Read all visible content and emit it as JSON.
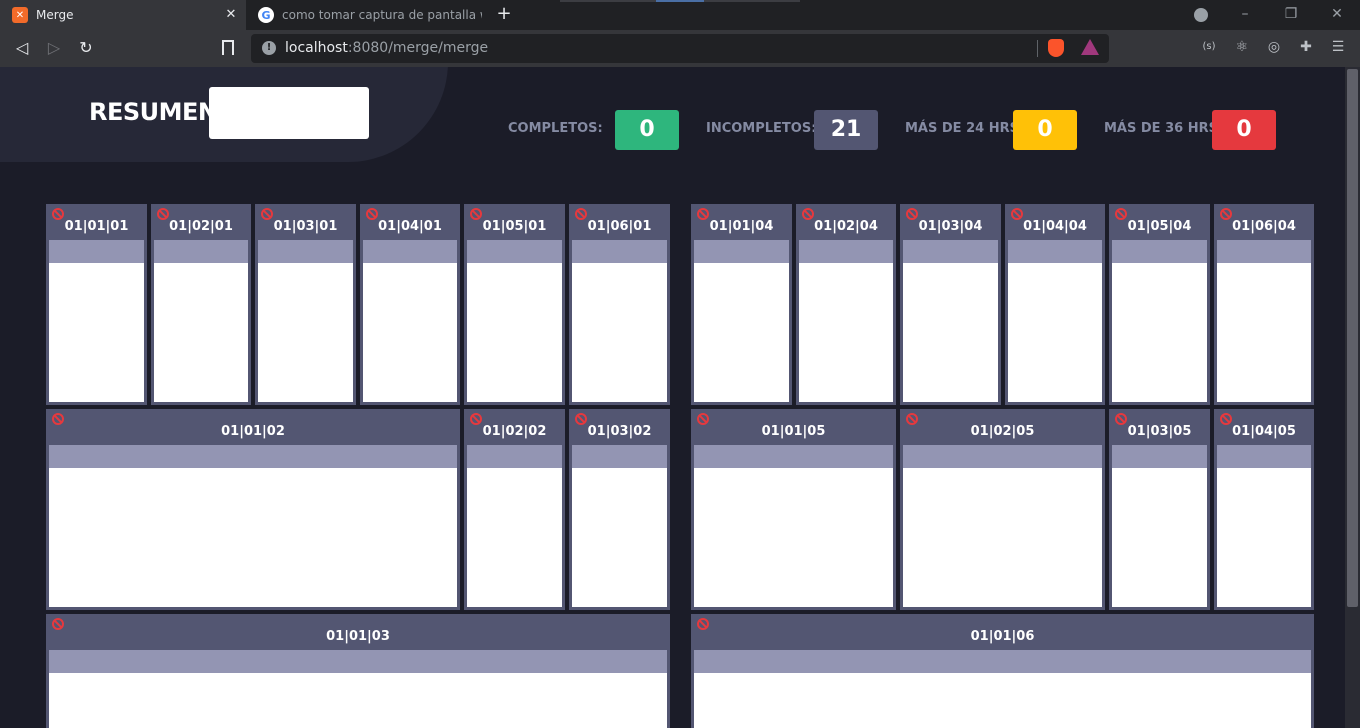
{
  "browser": {
    "tabs": [
      {
        "title": "Merge",
        "icon": "xampp-icon"
      },
      {
        "title": "como tomar captura de pantalla windo",
        "icon": "google-icon"
      }
    ],
    "url_host": "localhost",
    "url_path": ":8080/merge/merge"
  },
  "summary": {
    "title": "RESUMEN",
    "search_value": "",
    "stats": [
      {
        "label": "COMPLETOS:",
        "value": "0",
        "color": "#2eb67d"
      },
      {
        "label": "INCOMPLETOS:",
        "value": "21",
        "color": "#535672"
      },
      {
        "label": "MÁS DE 24 HRS:",
        "value": "0",
        "color": "#ffc107"
      },
      {
        "label": "MÁS DE 36 HRS:",
        "value": "0",
        "color": "#e5393e"
      }
    ]
  },
  "cells": {
    "c01_01_01": "01|01|01",
    "c01_02_01": "01|02|01",
    "c01_03_01": "01|03|01",
    "c01_04_01": "01|04|01",
    "c01_05_01": "01|05|01",
    "c01_06_01": "01|06|01",
    "c01_01_04": "01|01|04",
    "c01_02_04": "01|02|04",
    "c01_03_04": "01|03|04",
    "c01_04_04": "01|04|04",
    "c01_05_04": "01|05|04",
    "c01_06_04": "01|06|04",
    "c01_01_02": "01|01|02",
    "c01_02_02": "01|02|02",
    "c01_03_02": "01|03|02",
    "c01_01_05": "01|01|05",
    "c01_02_05": "01|02|05",
    "c01_03_05": "01|03|05",
    "c01_04_05": "01|04|05",
    "c01_01_03": "01|01|03",
    "c01_01_06": "01|01|06"
  },
  "colors": {
    "blocked_icon": "#e5393e",
    "cell_header": "#535672",
    "cell_bar": "#9395b3"
  }
}
